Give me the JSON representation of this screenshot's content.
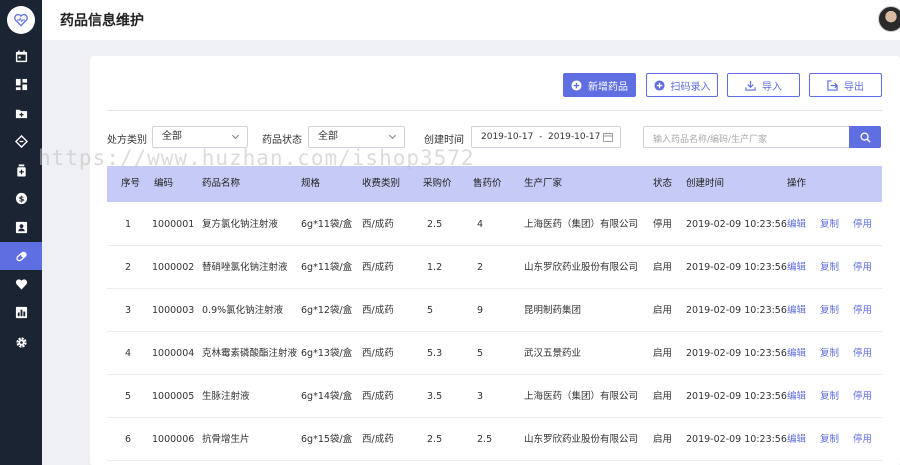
{
  "header": {
    "title": "药品信息维护"
  },
  "sidebar": {
    "items": [
      {
        "icon": "calendar-icon"
      },
      {
        "icon": "dashboard-icon"
      },
      {
        "icon": "folder-plus-icon"
      },
      {
        "icon": "tag-icon"
      },
      {
        "icon": "bottle-icon"
      },
      {
        "icon": "dollar-icon"
      },
      {
        "icon": "contact-card-icon"
      },
      {
        "icon": "pill-icon",
        "active": true
      },
      {
        "icon": "heart-icon"
      },
      {
        "icon": "bar-chart-icon"
      },
      {
        "icon": "settings-icon"
      }
    ]
  },
  "toolbar": {
    "add_label": "新增药品",
    "scan_label": "扫码录入",
    "import_label": "导入",
    "export_label": "导出"
  },
  "filters": {
    "rx_label": "处方类别",
    "rx_value": "全部",
    "status_label": "药品状态",
    "status_value": "全部",
    "created_label": "创建时间",
    "date_range": "2019-10-17  -  2019-10-17",
    "search_placeholder": "输入药品名称/编码/生产厂家"
  },
  "watermark": "https://www.huzhan.com/ishop3572",
  "table": {
    "columns": [
      "序号",
      "编码",
      "药品名称",
      "规格",
      "收费类别",
      "采购价",
      "售药价",
      "生产厂家",
      "状态",
      "创建时间",
      "操作"
    ],
    "actions": [
      "编辑",
      "复制",
      "停用"
    ],
    "rows": [
      [
        "1",
        "1000001",
        "复方氯化钠注射液",
        "6g*11袋/盒",
        "西/成药",
        "2.5",
        "4",
        "上海医药（集团）有限公司",
        "停用",
        "2019-02-09 10:23:56"
      ],
      [
        "2",
        "1000002",
        "替硝唑氯化钠注射液",
        "6g*11袋/盒",
        "西/成药",
        "1.2",
        "2",
        "山东罗欣药业股份有限公司",
        "启用",
        "2019-02-09 10:23:56"
      ],
      [
        "3",
        "1000003",
        "0.9%氯化钠注射液",
        "6g*12袋/盒",
        "西/成药",
        "5",
        "9",
        "昆明制药集团",
        "启用",
        "2019-02-09 10:23:56"
      ],
      [
        "4",
        "1000004",
        "克林霉素磷酸酯注射液",
        "6g*13袋/盒",
        "西/成药",
        "5.3",
        "5",
        "武汉五景药业",
        "启用",
        "2019-02-09 10:23:56"
      ],
      [
        "5",
        "1000005",
        "生脉注射液",
        "6g*14袋/盒",
        "西/成药",
        "3.5",
        "3",
        "上海医药（集团）有限公司",
        "启用",
        "2019-02-09 10:23:56"
      ],
      [
        "6",
        "1000006",
        "抗骨增生片",
        "6g*15袋/盒",
        "西/成药",
        "2.5",
        "2.5",
        "山东罗欣药业股份有限公司",
        "启用",
        "2019-02-09 10:23:56"
      ]
    ]
  }
}
